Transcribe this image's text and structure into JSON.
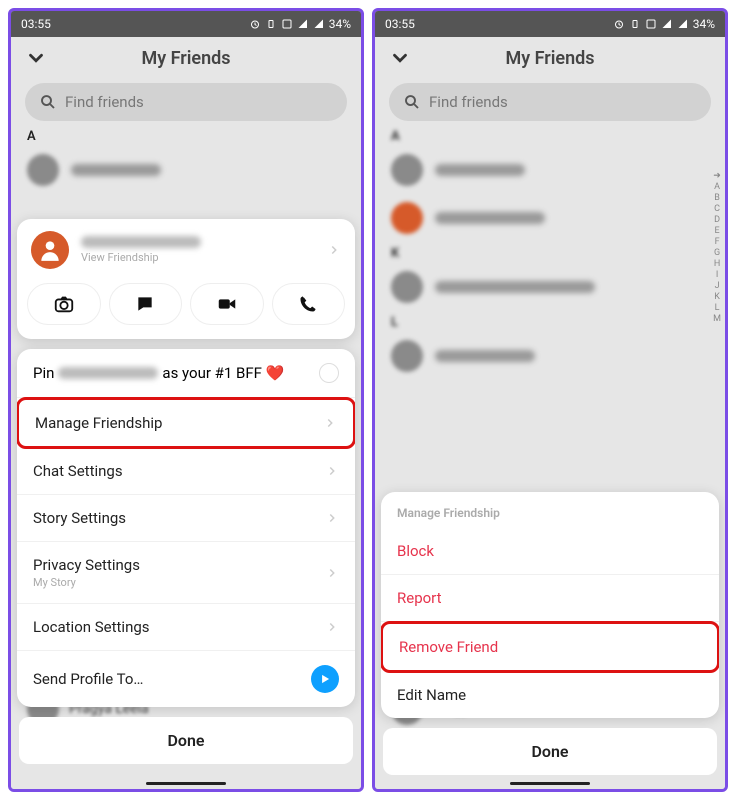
{
  "status": {
    "time": "03:55",
    "battery": "34%"
  },
  "header": {
    "title": "My Friends"
  },
  "search": {
    "placeholder": "Find friends"
  },
  "sections": {
    "a": "A",
    "k": "K",
    "l": "L"
  },
  "alpha_index": [
    "➜",
    "A",
    "B",
    "C",
    "D",
    "E",
    "F",
    "G",
    "H",
    "I",
    "J",
    "K",
    "L",
    "M"
  ],
  "profile": {
    "view_friendship": "View Friendship"
  },
  "pin": {
    "prefix": "Pin",
    "suffix": "as your #1 BFF ❤️"
  },
  "menu1": {
    "manage": "Manage Friendship",
    "chat": "Chat Settings",
    "story": "Story Settings",
    "privacy": "Privacy Settings",
    "privacy_sub": "My Story",
    "location": "Location Settings",
    "send": "Send Profile To…"
  },
  "menu2": {
    "title": "Manage Friendship",
    "block": "Block",
    "report": "Report",
    "remove": "Remove Friend",
    "edit": "Edit Name"
  },
  "done": "Done",
  "below_name": "Pragya Leela"
}
